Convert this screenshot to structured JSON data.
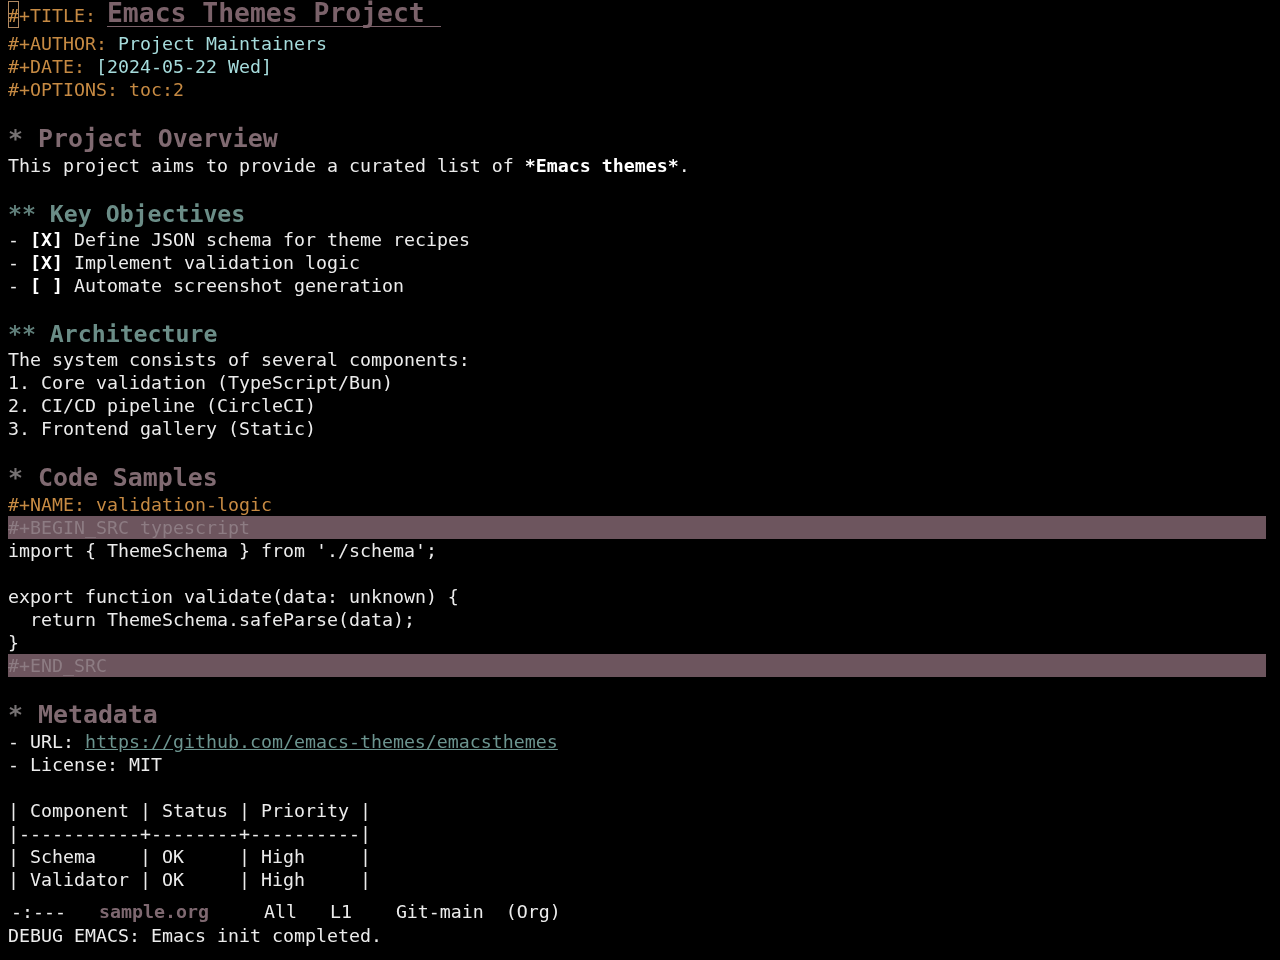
{
  "buffer": {
    "keywords": [
      {
        "kind": "title",
        "keyword": "#+TITLE:",
        "value": "Emacs Themes Project",
        "cursor": true
      },
      {
        "kind": "author",
        "keyword": "#+AUTHOR:",
        "value": "Project Maintainers"
      },
      {
        "kind": "date",
        "keyword": "#+DATE:",
        "value": "[2024-05-22 Wed]"
      },
      {
        "kind": "options",
        "keyword": "#+OPTIONS:",
        "value": "toc:2"
      }
    ],
    "outline": [
      {
        "marker": "*",
        "title": "Project Overview",
        "body": [
          {
            "kind": "paragraph",
            "runs": [
              {
                "text": "This project aims to provide a curated list of ",
                "bold": false
              },
              {
                "text": "*Emacs themes*",
                "bold": true
              },
              {
                "text": ".",
                "bold": false
              }
            ]
          }
        ],
        "children": [
          {
            "marker": "**",
            "title": "Key Objectives",
            "body": [
              {
                "kind": "checklist",
                "items": [
                  "- **[X]** Define JSON schema for theme recipes",
                  "- **[X]** Implement validation logic",
                  "- **[ ]** Automate screenshot generation"
                ]
              }
            ]
          },
          {
            "marker": "**",
            "title": "Architecture",
            "body": [
              {
                "kind": "text",
                "text": "The system consists of several components:"
              },
              {
                "kind": "ordered_list",
                "items": [
                  "1. Core validation (TypeScript/Bun)",
                  "2. CI/CD pipeline (CircleCI)",
                  "3. Frontend gallery (Static)"
                ]
              }
            ]
          }
        ]
      },
      {
        "marker": "*",
        "title": "Code Samples",
        "body": [
          {
            "kind": "src_block",
            "name_keyword": "#+NAME:",
            "name": "validation-logic",
            "begin": "#+BEGIN_SRC typescript",
            "code": "import { ThemeSchema } from './schema';\n\nexport function validate(data: unknown) {\n  return ThemeSchema.safeParse(data);\n}",
            "end": "#+END_SRC"
          }
        ]
      },
      {
        "marker": "*",
        "title": "Metadata",
        "body": [
          {
            "kind": "link_item",
            "label": "- URL:",
            "url": "https://github.com/emacs-themes/emacsthemes"
          },
          {
            "kind": "text",
            "text": "- License: MIT"
          },
          {
            "kind": "table",
            "header": "| Component | Status | Priority |",
            "rule": "|-----------+--------+----------|",
            "rows": [
              "| Schema    | OK     | High     |",
              "| Validator | OK     | High     |"
            ]
          }
        ]
      }
    ]
  },
  "mode_line": {
    "status": "-:---",
    "buffer_name": "sample.org",
    "position": "All",
    "line": "L1",
    "branch": "Git-main",
    "mode": "(Org)"
  },
  "echo_area": "DEBUG EMACS: Emacs init completed."
}
